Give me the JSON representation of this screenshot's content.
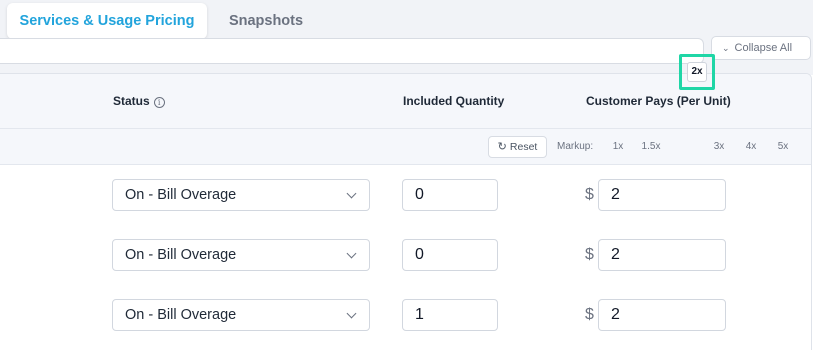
{
  "tabs": {
    "active": "Services & Usage Pricing",
    "inactive": "Snapshots"
  },
  "collapse_all_label": "Collapse All",
  "table": {
    "headers": {
      "status": "Status",
      "included_quantity": "Included Quantity",
      "customer_pays": "Customer Pays (Per Unit)"
    },
    "reset_label": "Reset",
    "markup_label": "Markup:",
    "markup_options": [
      "1x",
      "1.5x",
      "2x",
      "3x",
      "4x",
      "5x"
    ],
    "markup_selected": "2x",
    "currency_symbol": "$",
    "rows": [
      {
        "status": "On - Bill Overage",
        "included_quantity": "0",
        "price": "2"
      },
      {
        "status": "On - Bill Overage",
        "included_quantity": "0",
        "price": "2"
      },
      {
        "status": "On - Bill Overage",
        "included_quantity": "1",
        "price": "2"
      }
    ]
  },
  "colors": {
    "accent": "#22a4dc",
    "highlight": "#1fd6a6"
  }
}
